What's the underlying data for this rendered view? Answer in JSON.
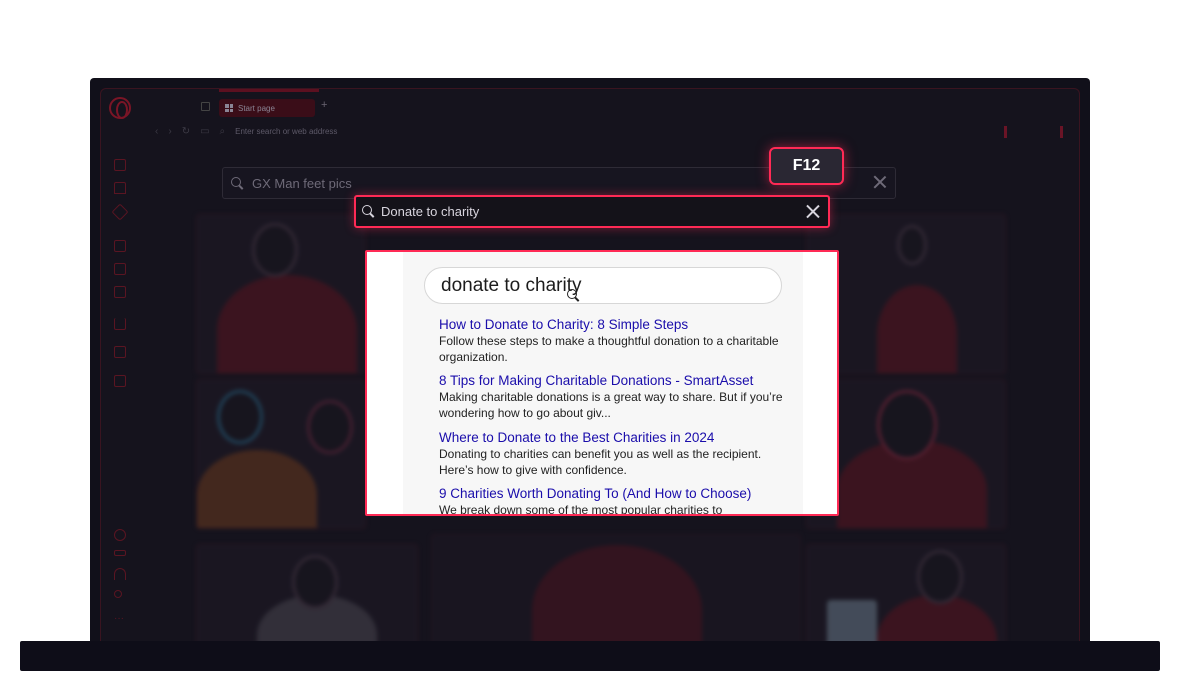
{
  "browser": {
    "tab": {
      "label": "Start page"
    },
    "new_tab_symbol": "+",
    "address_bar": {
      "placeholder": "Enter search or web address"
    }
  },
  "overlay": {
    "shortcut_badge": "F12",
    "background_search": {
      "query": "GX Man feet pics"
    },
    "foreground_search": {
      "query": "Donate to charity"
    }
  },
  "results_panel": {
    "search_query": "donate to charity",
    "results": [
      {
        "title": "How to Donate to Charity: 8 Simple Steps",
        "snippet": "Follow these steps to make a thoughtful donation to a charitable organization."
      },
      {
        "title": "8 Tips for Making Charitable Donations - SmartAsset",
        "snippet": "Making charitable donations is a great way to share. But if you’re wondering how to go about giv..."
      },
      {
        "title": "Where to Donate to the Best Charities in 2024",
        "snippet": "Donating to charities can benefit you as well as the recipient. Here’s how to give with confidence."
      },
      {
        "title": "9 Charities Worth Donating To (And How to Choose)",
        "snippet": "We break down some of the most popular charities to"
      }
    ]
  },
  "colors": {
    "accent": "#ff2a55",
    "link": "#1a0dab",
    "screen_bg": "#15131d"
  },
  "sidebar_icons": [
    "gamepad-icon",
    "home-icon",
    "send-icon",
    "cake-icon",
    "chat-icon",
    "messenger-icon",
    "download-icon",
    "box-icon",
    "player-icon",
    "settings-icon",
    "battery-icon",
    "wifi-icon",
    "music-icon",
    "more-icon"
  ]
}
